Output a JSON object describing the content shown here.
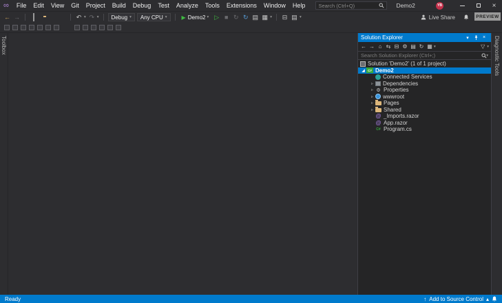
{
  "titlebar": {
    "menus": [
      "File",
      "Edit",
      "View",
      "Git",
      "Project",
      "Build",
      "Debug",
      "Test",
      "Analyze",
      "Tools",
      "Extensions",
      "Window",
      "Help"
    ],
    "search_placeholder": "Search (Ctrl+Q)",
    "window_title": "Demo2",
    "avatar_initials": "YB",
    "preview_label": "PREVIEW"
  },
  "toolbar": {
    "configuration": "Debug",
    "platform": "Any CPU",
    "run_target": "Demo2",
    "live_share_label": "Live Share"
  },
  "rails": {
    "left_label": "Toolbox",
    "right_label": "Diagnostic Tools"
  },
  "solution_explorer": {
    "title": "Solution Explorer",
    "search_placeholder": "Search Solution Explorer (Ctrl+;)",
    "tree": [
      {
        "label": "Solution 'Demo2' (1 of 1 project)",
        "icon": "solution-icon",
        "level": 0,
        "expanded": true
      },
      {
        "label": "Demo2",
        "icon": "csharp-project-icon",
        "level": 1,
        "expanded": true,
        "selected": true
      },
      {
        "label": "Connected Services",
        "icon": "connected-services-icon",
        "level": 2
      },
      {
        "label": "Dependencies",
        "icon": "dependencies-icon",
        "level": 2,
        "expanded": false
      },
      {
        "label": "Properties",
        "icon": "properties-icon",
        "level": 2,
        "expanded": false
      },
      {
        "label": "wwwroot",
        "icon": "wwwroot-icon",
        "level": 2,
        "expanded": false
      },
      {
        "label": "Pages",
        "icon": "folder-icon",
        "level": 2,
        "expanded": false
      },
      {
        "label": "Shared",
        "icon": "folder-icon",
        "level": 2,
        "expanded": false
      },
      {
        "label": "_Imports.razor",
        "icon": "razor-file-icon",
        "level": 2
      },
      {
        "label": "App.razor",
        "icon": "razor-file-icon",
        "level": 2
      },
      {
        "label": "Program.cs",
        "icon": "csharp-file-icon",
        "level": 2
      }
    ]
  },
  "statusbar": {
    "left": "Ready",
    "source_control": "Add to Source Control"
  },
  "icons": {
    "logo": "∞",
    "close": "×",
    "back": "←",
    "forward": "→",
    "undo": "↶",
    "redo": "↷",
    "caret_down": "▾",
    "caret_up": "▴",
    "run": "▶",
    "run_outline": "▷",
    "stop": "■",
    "refresh": "↻",
    "home": "⌂",
    "sync": "⇆",
    "collapse_all": "⊟",
    "gear": "⚙",
    "show_all_files": "▤",
    "views": "▦",
    "filter": "▽",
    "twisty_expanded": "◢",
    "twisty_collapsed": "▹",
    "csharp_project": "C#",
    "csharp_file": "C#",
    "razor_at": "@",
    "up_arrow": "↑"
  },
  "colors": {
    "accent": "#007acc",
    "selection": "#007acc",
    "run_green": "#3fba41",
    "folder": "#dcb67a",
    "statusbar": "#007acc"
  }
}
